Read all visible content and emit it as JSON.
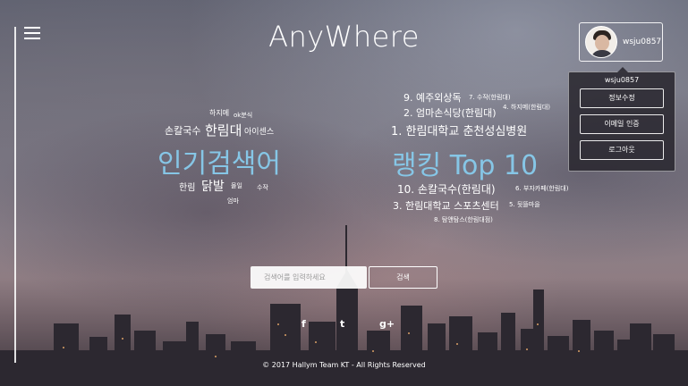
{
  "app": {
    "title": "AnyWhere"
  },
  "user": {
    "username": "wsju0857"
  },
  "dropdown": {
    "username": "wsju0857",
    "items": [
      {
        "label": "정보수정"
      },
      {
        "label": "이메일 인증"
      },
      {
        "label": "로그아웃"
      }
    ]
  },
  "popular": {
    "title": "인기검색어",
    "words": [
      "하지메",
      "ok분식",
      "손칼국수",
      "한림대",
      "아이센스",
      "한림",
      "닭발",
      "몰일",
      "수작",
      "엄마"
    ]
  },
  "ranking": {
    "title": "랭킹 Top 10",
    "items": [
      {
        "label": "1. 한림대학교 춘천성심병원"
      },
      {
        "label": "2. 엄마손식당(한림대)"
      },
      {
        "label": "3. 한림대학교 스포츠센터"
      },
      {
        "label": "4. 하지메(한림대)"
      },
      {
        "label": "5. 뒷뜰마을"
      },
      {
        "label": "6. 부자카페(한림대)"
      },
      {
        "label": "7. 수작(한림대)"
      },
      {
        "label": "8. 탐앤탐스(한림대점)"
      },
      {
        "label": "9. 예주외상독"
      },
      {
        "label": "10. 손칼국수(한림대)"
      }
    ]
  },
  "search": {
    "placeholder": "검색어를 입력하세요",
    "button_label": "검색"
  },
  "social": {
    "facebook": "f",
    "twitter": "t",
    "googleplus": "g+"
  },
  "footer": {
    "text": "© 2017 Hallym Team KT - All Rights Reserved"
  },
  "colors": {
    "accent": "#86c6e6"
  }
}
